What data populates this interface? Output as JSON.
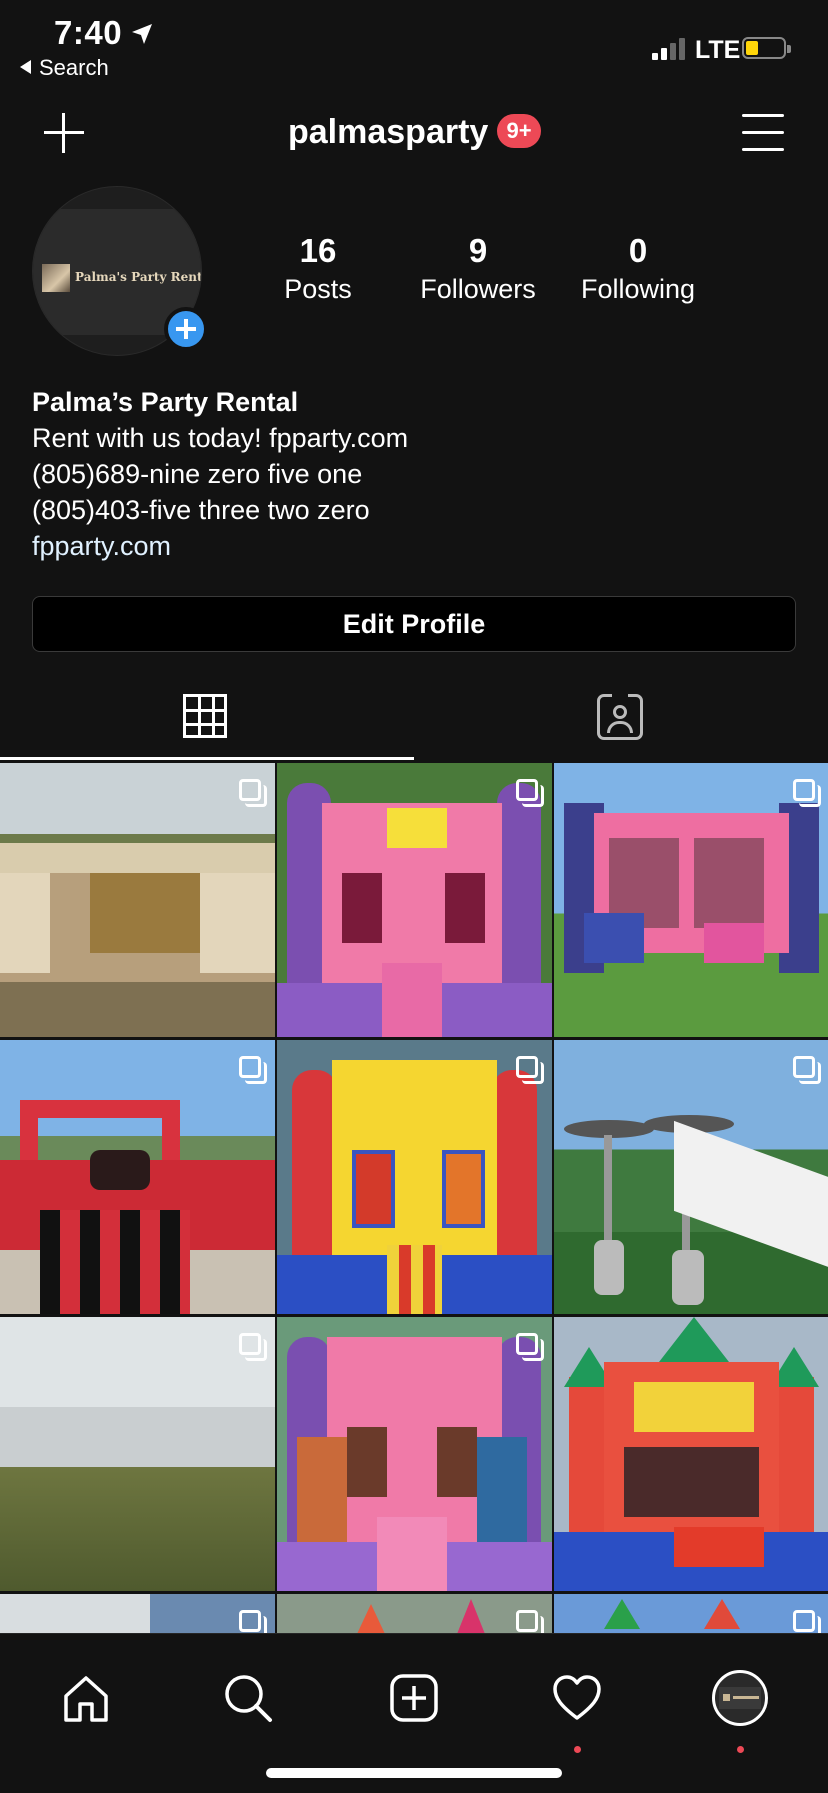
{
  "status_bar": {
    "time": "7:40",
    "back_label": "Search",
    "network": "LTE"
  },
  "header": {
    "username": "palmasparty",
    "notification_badge": "9+"
  },
  "profile": {
    "avatar_text": "Palma's Party Rental",
    "stats": [
      {
        "value": "16",
        "label": "Posts"
      },
      {
        "value": "9",
        "label": "Followers"
      },
      {
        "value": "0",
        "label": "Following"
      }
    ],
    "bio": {
      "name": "Palma’s Party Rental",
      "lines": [
        "Rent with us today! fpparty.com",
        "(805)689-nine zero five one",
        "(805)403-five three two zero"
      ],
      "website": "fpparty.com"
    },
    "edit_button": "Edit Profile"
  },
  "tabs": [
    {
      "name": "grid",
      "icon": "grid-icon",
      "active": true
    },
    {
      "name": "tagged",
      "icon": "tagged-icon",
      "active": false
    }
  ],
  "posts": [
    {
      "subject": "beige tent",
      "multiple": true
    },
    {
      "subject": "pink purple castle bounce house",
      "multiple": true
    },
    {
      "subject": "pink castle combo bounce house",
      "multiple": true
    },
    {
      "subject": "red mechanical bull inflatable",
      "multiple": true
    },
    {
      "subject": "yellow red bounce house",
      "multiple": true
    },
    {
      "subject": "patio heaters and white tent",
      "multiple": true
    },
    {
      "subject": "white tent interior",
      "multiple": true
    },
    {
      "subject": "pink princess bounce house",
      "multiple": true
    },
    {
      "subject": "red yellow bounce house",
      "multiple": false
    },
    {
      "subject": "partial post",
      "multiple": true
    },
    {
      "subject": "partial post",
      "multiple": true
    },
    {
      "subject": "partial post",
      "multiple": true
    }
  ],
  "colors": {
    "background": "#121212",
    "accent_blue": "#3897f0",
    "badge_red": "#ed4956"
  },
  "nav": [
    {
      "name": "home",
      "icon": "home-icon"
    },
    {
      "name": "search",
      "icon": "search-icon"
    },
    {
      "name": "new-post",
      "icon": "add-post-icon"
    },
    {
      "name": "activity",
      "icon": "heart-icon",
      "has_dot": true
    },
    {
      "name": "profile",
      "icon": "profile-avatar",
      "has_dot": true
    }
  ]
}
